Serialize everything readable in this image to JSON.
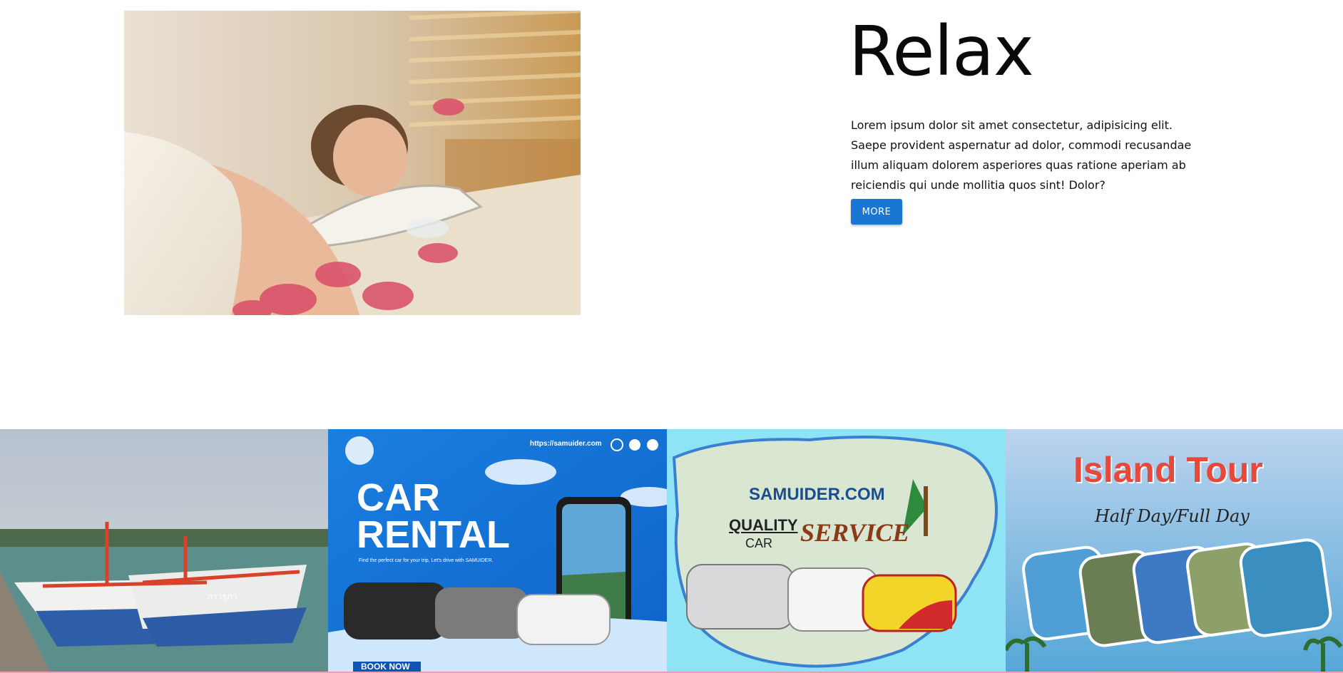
{
  "section": {
    "title": "Relax",
    "description": "Lorem ipsum dolor sit amet consectetur, adipisicing elit. Saepe provident aspernatur ad dolor, commodi recusandae illum aliquam dolorem asperiores quas ratione aperiam ab reiciendis qui unde mollitia quos sint! Dolor?",
    "button_label": "MORE",
    "accent_color": "#1976d2"
  },
  "gallery": {
    "boat": {
      "boat_name": "ภาวรุภา"
    },
    "car_rental": {
      "url": "https://samuider.com",
      "headline_1": "CAR",
      "headline_2": "RENTAL",
      "tagline": "Find the perfect car for your trip, Let's drive with SAMUIDER.",
      "cta": "BOOK NOW"
    },
    "car_service": {
      "brand": "SAMUIDER.COM",
      "quality": "QUALITY",
      "car": "CAR",
      "service": "SERVICE"
    },
    "island_tour": {
      "title": "Island Tour",
      "subtitle": "Half Day/Full Day"
    }
  }
}
